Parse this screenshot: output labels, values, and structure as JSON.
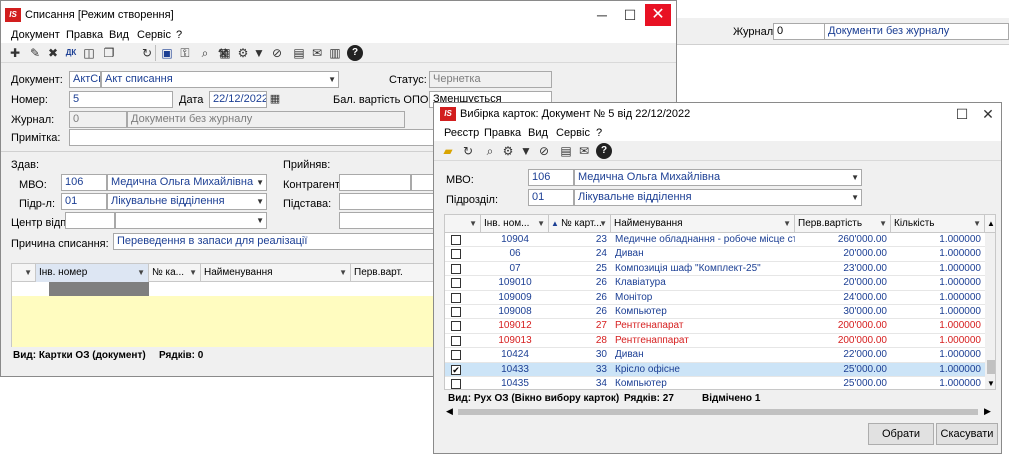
{
  "bg_window": {
    "journal_label": "Журнал:",
    "journal_code": "0",
    "journal_name": "Документи без журналу"
  },
  "main_window": {
    "title": "Списання [Режим створення]",
    "menu": [
      "Документ",
      "Правка",
      "Вид",
      "Сервіс",
      "?"
    ],
    "form": {
      "document_label": "Документ:",
      "document_code": "АктСп",
      "document_name": "Акт списання",
      "status_label": "Статус:",
      "status_value": "Чернетка",
      "number_label": "Номер:",
      "number_value": "5",
      "date_label": "Дата",
      "date_value": "22/12/2022",
      "balance_label": "Бал. вартість ОПО:",
      "balance_value": "Зменшується",
      "journal_label": "Журнал:",
      "journal_code": "0",
      "journal_name": "Документи без журналу",
      "note_label": "Примітка:",
      "gave_label": "Здав:",
      "mvo_label": "МВО:",
      "mvo_code": "106",
      "mvo_name": "Медична Ольга Михайлівна",
      "dept_label": "Підр-л:",
      "dept_code": "01",
      "dept_name": "Лікувальне відділення",
      "resp_center_label": "Центр відп.:",
      "received_label": "Прийняв:",
      "counterparty_label": "Контрагент:",
      "basis_label": "Підстава:",
      "reason_label": "Причина списання:",
      "reason_value": "Переведення в запаси для реалізації"
    },
    "grid_headers": [
      "Інв. номер",
      "№ ка...",
      "Найменування",
      "Перв.варт."
    ],
    "status_view": "Вид: Картки ОЗ (документ)",
    "status_rows": "Рядків: 0"
  },
  "dialog": {
    "title": "Вибірка карток: Документ № 5 від 22/12/2022",
    "menu": [
      "Реєстр",
      "Правка",
      "Вид",
      "Сервіс",
      "?"
    ],
    "mvo_label": "МВО:",
    "mvo_code": "106",
    "mvo_name": "Медична Ольга Михайлівна",
    "dept_label": "Підрозділ:",
    "dept_code": "01",
    "dept_name": "Лікувальне відділення",
    "headers": [
      "Інв. ном...",
      "№ карт...",
      "Найменування",
      "Перв.вартість",
      "Кількість"
    ],
    "rows": [
      {
        "checked": false,
        "inv": "10904",
        "card": "23",
        "name": "Медичне обладнання - робоче місце стом...",
        "cost": "260'000.00",
        "qty": "1.000000",
        "color": "#1c3f94",
        "selected": false
      },
      {
        "checked": false,
        "inv": "06",
        "card": "24",
        "name": "Диван",
        "cost": "20'000.00",
        "qty": "1.000000",
        "color": "#1c3f94",
        "selected": false
      },
      {
        "checked": false,
        "inv": "07",
        "card": "25",
        "name": "Композиція шаф \"Комплект-25\"",
        "cost": "23'000.00",
        "qty": "1.000000",
        "color": "#1c3f94",
        "selected": false
      },
      {
        "checked": false,
        "inv": "109010",
        "card": "26",
        "name": "Клавіатура",
        "cost": "20'000.00",
        "qty": "1.000000",
        "color": "#1c3f94",
        "selected": false
      },
      {
        "checked": false,
        "inv": "109009",
        "card": "26",
        "name": "Монітор",
        "cost": "24'000.00",
        "qty": "1.000000",
        "color": "#1c3f94",
        "selected": false
      },
      {
        "checked": false,
        "inv": "109008",
        "card": "26",
        "name": "Компьютер",
        "cost": "30'000.00",
        "qty": "1.000000",
        "color": "#1c3f94",
        "selected": false
      },
      {
        "checked": false,
        "inv": "109012",
        "card": "27",
        "name": "Рентгенапарат",
        "cost": "200'000.00",
        "qty": "1.000000",
        "color": "#d62020",
        "selected": false
      },
      {
        "checked": false,
        "inv": "109013",
        "card": "28",
        "name": "Рентгенаппарат",
        "cost": "200'000.00",
        "qty": "1.000000",
        "color": "#d62020",
        "selected": false
      },
      {
        "checked": false,
        "inv": "10424",
        "card": "30",
        "name": "Диван",
        "cost": "22'000.00",
        "qty": "1.000000",
        "color": "#1c3f94",
        "selected": false
      },
      {
        "checked": true,
        "inv": "10433",
        "card": "33",
        "name": "Крісло офісне",
        "cost": "25'000.00",
        "qty": "1.000000",
        "color": "#1c3f94",
        "selected": true
      },
      {
        "checked": false,
        "inv": "10435",
        "card": "34",
        "name": "Компьютер",
        "cost": "25'000.00",
        "qty": "1.000000",
        "color": "#1c3f94",
        "selected": false
      }
    ],
    "status_view": "Вид: Рух ОЗ (Вікно вибору карток)",
    "status_rows": "Рядків: 27",
    "status_marked": "Відмічено 1",
    "ok_button": "Обрати",
    "cancel_button": "Скасувати"
  }
}
